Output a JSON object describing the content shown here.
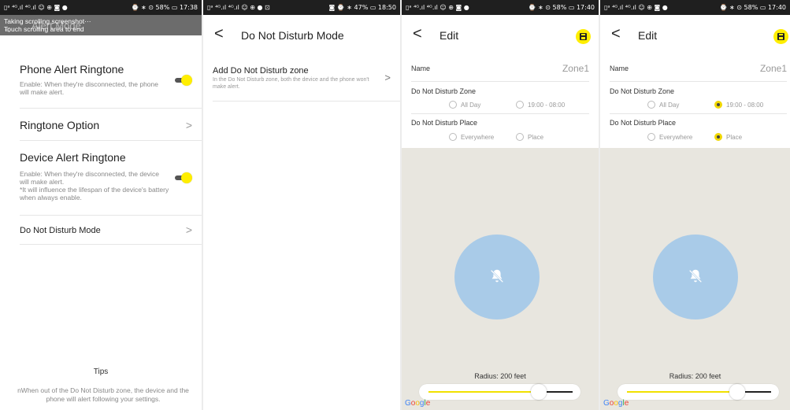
{
  "panel1": {
    "status": {
      "left": "▯ᵃ ⁴ᴳ.ıl ⁴ᴳ.ıl ☺ ⊕ ◙ ●",
      "right": "⌚ ∗ ⊙ 58% ▭ 17:38"
    },
    "header_title": "Alert Mode",
    "overlay_line1": "Taking scrolling screenshot···",
    "overlay_line2": "Touch scrolling area to end",
    "phone_alert": {
      "title": "Phone Alert Ringtone",
      "desc": "Enable: When they're disconnected, the phone will make alert.",
      "enabled": true
    },
    "ringtone_option": "Ringtone Option",
    "device_alert": {
      "title": "Device Alert Ringtone",
      "desc": "Enable: When they're disconnected, the device will make alert.",
      "note": "*It will influence the lifespan of the device's battery when always enable.",
      "enabled": true
    },
    "dnd_mode": "Do Not Disturb Mode",
    "tips_title": "Tips",
    "tips_body": "nWhen out of the Do Not Disturb zone, the device and the phone will alert following your settings."
  },
  "panel2": {
    "status": {
      "left": "▯ᵃ ⁴ᴳ.ıl ⁴ᴳ.ıl ☺ ⊕ ● ⊡",
      "right": "◙ ⌚ ∗ 47% ▭ 18:50"
    },
    "title": "Do Not Disturb Mode",
    "item_title": "Add Do Not Disturb zone",
    "item_desc": "In the Do Not Disturb zone, both the device and the phone won't make alert."
  },
  "panel3": {
    "status": {
      "left": "▯ᵃ ⁴ᴳ.ıl ⁴ᴳ.ıl ☺ ⊕ ◙ ●",
      "right": "⌚ ∗ ⊙ 58% ▭ 17:40"
    },
    "title": "Edit",
    "name_label": "Name",
    "name_value": "Zone1",
    "zone_label": "Do Not Disturb Zone",
    "zone_opt1": "All Day",
    "zone_opt2": "19:00 - 08:00",
    "zone_selected": "",
    "place_label": "Do Not Disturb Place",
    "place_opt1": "Everywhere",
    "place_opt2": "Place",
    "place_selected": "",
    "radius_label": "Radius: 200 feet",
    "slider_fraction": 0.8
  },
  "panel4": {
    "status": {
      "left": "▯ᵃ ⁴ᴳ.ıl ⁴ᴳ.ıl ☺ ⊕ ◙ ●",
      "right": "⌚ ∗ ⊙ 58% ▭ 17:40"
    },
    "title": "Edit",
    "name_label": "Name",
    "name_value": "Zone1",
    "zone_label": "Do Not Disturb Zone",
    "zone_opt1": "All Day",
    "zone_opt2": "19:00 - 08:00",
    "zone_selected": "19:00 - 08:00",
    "place_label": "Do Not Disturb Place",
    "place_opt1": "Everywhere",
    "place_opt2": "Place",
    "place_selected": "Place",
    "radius_label": "Radius: 200 feet",
    "slider_fraction": 0.8
  },
  "google_logo": "Google",
  "colors": {
    "accent": "#ffee00",
    "circle": "#a9cbe8",
    "map": "#e8e6df"
  }
}
